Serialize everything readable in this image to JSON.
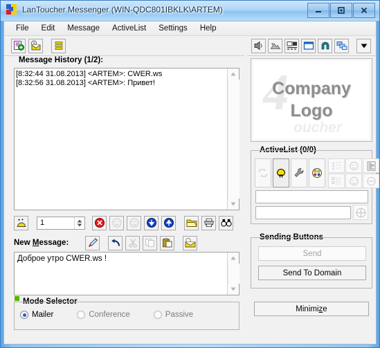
{
  "window": {
    "title": "LanToucher Messenger (WIN-QDC801IBKLK\\ARTEM)",
    "minimize_glyph": "minimize-icon",
    "maximize_glyph": "maximize-icon",
    "close_glyph": "close-icon",
    "accent": "#8ec3f0",
    "border": "#3a7fc4"
  },
  "menubar": {
    "items": [
      {
        "label": "File"
      },
      {
        "label": "Edit"
      },
      {
        "label": "Message"
      },
      {
        "label": "ActiveList"
      },
      {
        "label": "Settings"
      },
      {
        "label": "Help"
      }
    ]
  },
  "toolbar_left": {
    "buttons": [
      {
        "name": "new-message-icon"
      },
      {
        "name": "send-mail-icon"
      },
      {
        "name": "list-icon"
      }
    ]
  },
  "toolbar_right": {
    "buttons": [
      {
        "name": "speaker-icon"
      },
      {
        "name": "image-icon"
      },
      {
        "name": "network-computers-icon"
      },
      {
        "name": "window-icon"
      },
      {
        "name": "magnet-icon"
      },
      {
        "name": "windows-stack-icon"
      },
      {
        "name": "dropdown-arrow-icon"
      }
    ]
  },
  "history": {
    "label": "Message History (1/2):",
    "rows": [
      {
        "text": "[8:32:44 31.08.2013] <ARTEM>: CWER.ws",
        "selected": true
      },
      {
        "text": "[8:32:56 31.08.2013] <ARTEM>: Привет!",
        "selected": false
      }
    ],
    "scroll_up": "scroll-up-arrow",
    "scroll_down": "scroll-down-arrow"
  },
  "history_tools": {
    "compose_icon": "compose-message-icon",
    "count_value": "1",
    "count_placeholder": "1",
    "buttons": [
      {
        "name": "delete-icon",
        "disabled": false
      },
      {
        "name": "smiley-prev-icon",
        "disabled": true
      },
      {
        "name": "smiley-next-icon",
        "disabled": true
      },
      {
        "name": "arrow-down-icon",
        "disabled": false
      },
      {
        "name": "arrow-up-icon",
        "disabled": false
      },
      {
        "name": "folder-icon",
        "disabled": false
      },
      {
        "name": "print-icon",
        "disabled": false
      },
      {
        "name": "find-icon",
        "disabled": false
      }
    ]
  },
  "new_message": {
    "label": "New Message:",
    "label_accesskey": "M",
    "tools": [
      {
        "name": "pen-icon",
        "disabled": false
      },
      {
        "name": "undo-icon",
        "disabled": false
      },
      {
        "name": "cut-icon",
        "disabled": true
      },
      {
        "name": "copy-icon",
        "disabled": true
      },
      {
        "name": "paste-icon",
        "disabled": false
      },
      {
        "name": "open-folder-icon",
        "disabled": false
      }
    ],
    "text": "Доброе утро CWER.ws !",
    "placeholder": ""
  },
  "mode_selector": {
    "label": "Mode Selector",
    "options": [
      {
        "label": "Mailer",
        "selected": true
      },
      {
        "label": "Conference",
        "selected": false
      },
      {
        "label": "Passive",
        "selected": false
      }
    ]
  },
  "logo": {
    "line1": "Company",
    "line2": "Logo",
    "watermark": "4",
    "watermark_text": "oucher"
  },
  "activelist": {
    "label": "ActiveList (0/0)",
    "buttons": [
      {
        "name": "refresh-icon",
        "disabled": true,
        "pressed": false
      },
      {
        "name": "lamp-icon",
        "disabled": false,
        "pressed": true
      },
      {
        "name": "wrench-icon",
        "disabled": false,
        "pressed": false
      },
      {
        "name": "palette-icon",
        "disabled": false,
        "pressed": false
      }
    ],
    "small_buttons": [
      {
        "name": "list-check-icon",
        "disabled": true
      },
      {
        "name": "face-icon",
        "disabled": true
      },
      {
        "name": "document-icon",
        "disabled": true
      },
      {
        "name": "list-box-icon",
        "disabled": true
      },
      {
        "name": "face-alt-icon",
        "disabled": true
      },
      {
        "name": "minus-circle-icon",
        "disabled": true
      }
    ],
    "input1_value": "",
    "input1_placeholder": "",
    "input2_value": "",
    "input2_placeholder": "",
    "add_icon": "add-circle-icon"
  },
  "sending": {
    "label": "Sending Buttons",
    "send_label": "Send",
    "send_disabled": true,
    "domain_label": "Send To Domain",
    "minimize_label": "Minimize"
  }
}
